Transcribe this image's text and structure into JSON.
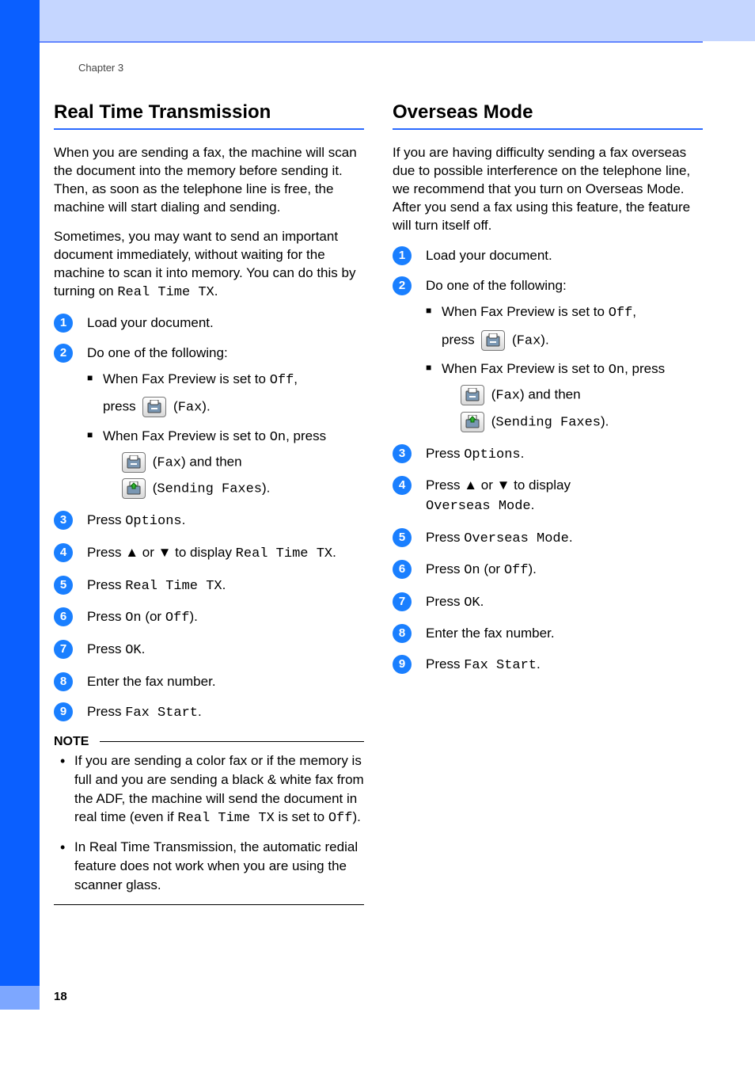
{
  "chapter": "Chapter 3",
  "page_number": "18",
  "left": {
    "heading": "Real Time Transmission",
    "para1": "When you are sending a fax, the machine will scan the document into the memory before sending it. Then, as soon as the telephone line is free, the machine will start dialing and sending.",
    "para2_a": "Sometimes, you may want to send an important document immediately, without waiting for the machine to scan it into memory. You can do this by turning on ",
    "para2_mono": "Real Time TX",
    "para2_b": ".",
    "steps": [
      {
        "n": "1",
        "type": "simple",
        "text": "Load your document."
      },
      {
        "n": "2",
        "type": "fax_choice",
        "lead": "Do one of the following:",
        "b1a": "When Fax Preview is set to ",
        "b1m": "Off",
        "b1b": ",",
        "b1c": "press ",
        "b1d": " (",
        "b1e": "Fax",
        "b1f": ").",
        "b2a": "When Fax Preview is set to ",
        "b2m": "On",
        "b2b": ", press",
        "b2c": " (",
        "b2d": "Fax",
        "b2e": ") and then",
        "b2f": " (",
        "b2g": "Sending Faxes",
        "b2h": ")."
      },
      {
        "n": "3",
        "type": "press",
        "a": "Press ",
        "m": "Options",
        "b": "."
      },
      {
        "n": "4",
        "type": "arrow_display",
        "a": "Press ",
        "up": "▲",
        "mid": " or ",
        "down": "▼",
        "b": " to display ",
        "m": "Real Time TX",
        "c": "."
      },
      {
        "n": "5",
        "type": "press",
        "a": "Press ",
        "m": "Real Time TX",
        "b": "."
      },
      {
        "n": "6",
        "type": "press_onoff",
        "a": "Press ",
        "m1": "On",
        "mid": " (or ",
        "m2": "Off",
        "b": ")."
      },
      {
        "n": "7",
        "type": "press",
        "a": "Press ",
        "m": "OK",
        "b": "."
      },
      {
        "n": "8",
        "type": "simple",
        "text": "Enter the fax number."
      },
      {
        "n": "9",
        "type": "press",
        "a": "Press ",
        "m": "Fax Start",
        "b": "."
      }
    ],
    "note_label": "NOTE",
    "notes": [
      {
        "a": "If you are sending a color fax or if the memory is full and you are sending a black & white fax from the ADF, the machine will send the document in real time (even if ",
        "m1": "Real Time TX",
        "mid": " is set to ",
        "m2": "Off",
        "b": ")."
      },
      {
        "a": "In Real Time Transmission, the automatic redial feature does not work when you are using the scanner glass."
      }
    ]
  },
  "right": {
    "heading": "Overseas Mode",
    "para": "If you are having difficulty sending a fax overseas due to possible interference on the telephone line, we recommend that you turn on Overseas Mode. After you send a fax using this feature, the feature will turn itself off.",
    "steps": [
      {
        "n": "1",
        "type": "simple",
        "text": "Load your document."
      },
      {
        "n": "2",
        "type": "fax_choice",
        "lead": "Do one of the following:",
        "b1a": "When Fax Preview is set to ",
        "b1m": "Off",
        "b1b": ",",
        "b1c": "press ",
        "b1d": " (",
        "b1e": "Fax",
        "b1f": ").",
        "b2a": "When Fax Preview is set to ",
        "b2m": "On",
        "b2b": ", press",
        "b2c": " (",
        "b2d": "Fax",
        "b2e": ") and then",
        "b2f": " (",
        "b2g": "Sending Faxes",
        "b2h": ")."
      },
      {
        "n": "3",
        "type": "press",
        "a": "Press ",
        "m": "Options",
        "b": "."
      },
      {
        "n": "4",
        "type": "arrow_display_2line",
        "a": "Press ",
        "up": "▲",
        "mid": " or ",
        "down": "▼",
        "b": " to display",
        "m": "Overseas Mode",
        "c": "."
      },
      {
        "n": "5",
        "type": "press",
        "a": "Press ",
        "m": "Overseas Mode",
        "b": "."
      },
      {
        "n": "6",
        "type": "press_onoff",
        "a": "Press ",
        "m1": "On",
        "mid": " (or ",
        "m2": "Off",
        "b": ")."
      },
      {
        "n": "7",
        "type": "press",
        "a": "Press ",
        "m": "OK",
        "b": "."
      },
      {
        "n": "8",
        "type": "simple",
        "text": "Enter the fax number."
      },
      {
        "n": "9",
        "type": "press",
        "a": "Press ",
        "m": "Fax Start",
        "b": "."
      }
    ]
  }
}
